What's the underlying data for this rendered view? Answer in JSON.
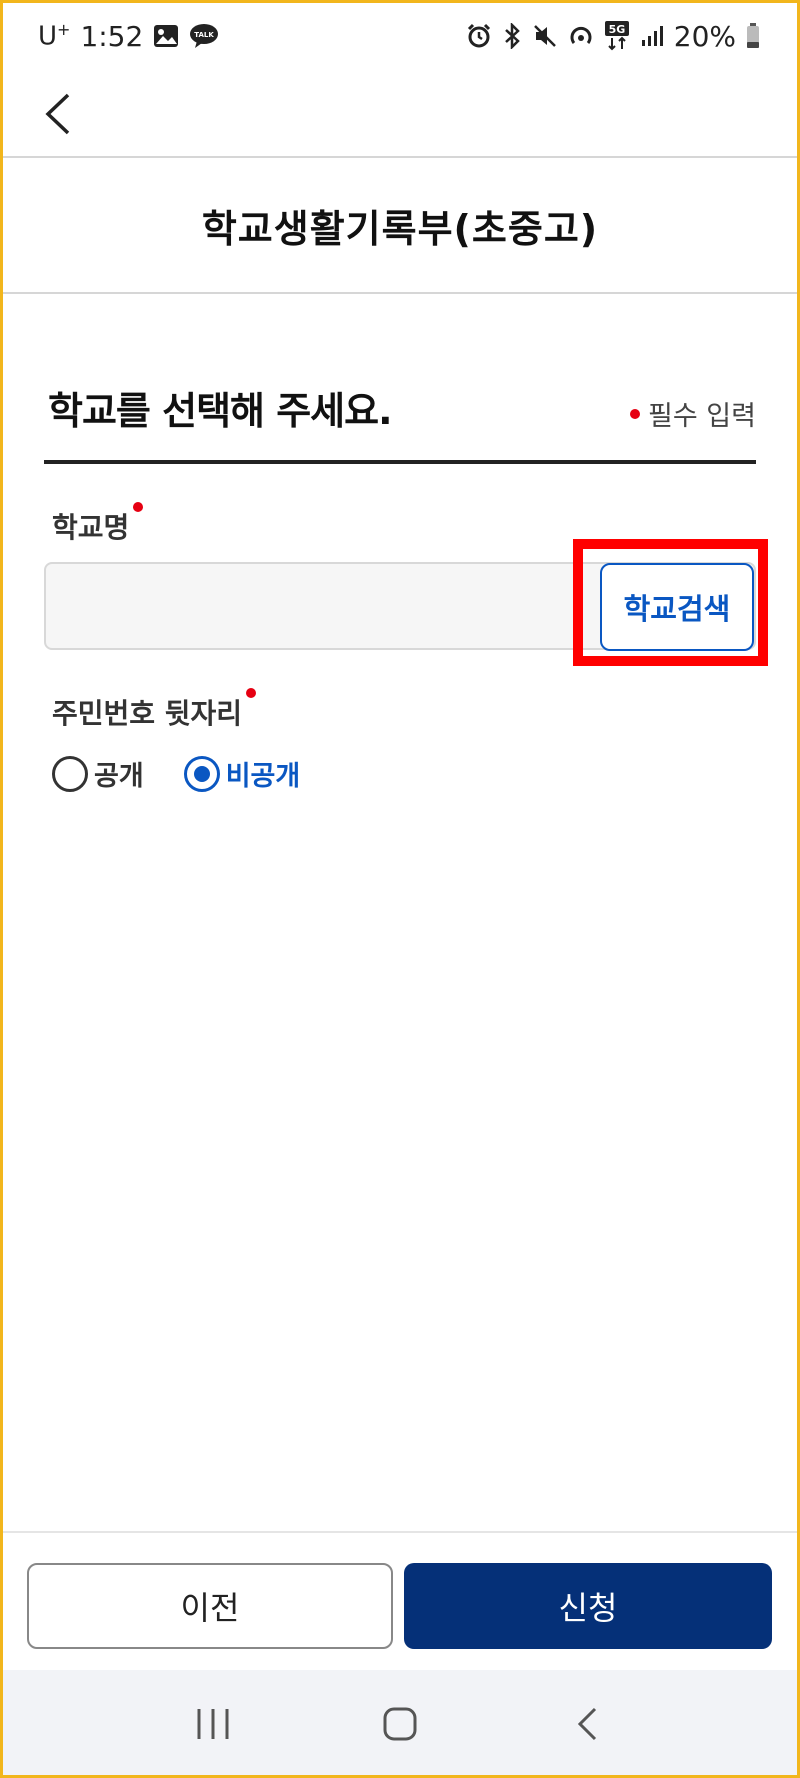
{
  "status_bar": {
    "carrier": "U",
    "carrier_sup": "+",
    "time": "1:52",
    "battery": "20%",
    "network": "5G"
  },
  "app_bar": {
    "back_icon": "chevron-left-icon"
  },
  "title": "학교생활기록부(초중고)",
  "section": {
    "heading": "학교를 선택해 주세요.",
    "required_note": "필수 입력"
  },
  "school_field": {
    "label": "학교명",
    "value": "",
    "search_button": "학교검색"
  },
  "id_field": {
    "label": "주민번호 뒷자리",
    "options": [
      {
        "label": "공개",
        "checked": false
      },
      {
        "label": "비공개",
        "checked": true
      }
    ]
  },
  "buttons": {
    "prev": "이전",
    "apply": "신청"
  },
  "colors": {
    "accent_blue": "#0a57c2",
    "primary_navy": "#053078",
    "required_red": "#e60012",
    "highlight_red": "#ff0000",
    "frame_yellow": "#f2b61c"
  }
}
